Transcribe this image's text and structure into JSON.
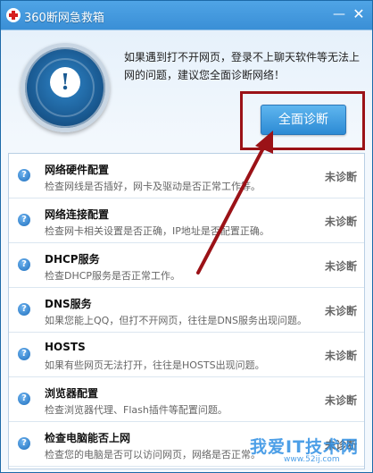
{
  "window": {
    "title": "360断网急救箱",
    "minimize_label": "—",
    "close_label": "✕"
  },
  "hero": {
    "message": "如果遇到打不开网页，登录不上聊天软件等无法上网的问题，建议您全面诊断网络！",
    "diagnose_button": "全面诊断"
  },
  "checks": [
    {
      "title": "网络硬件配置",
      "desc": "检查网线是否插好，网卡及驱动是否正常工作等。",
      "status": "未诊断",
      "icon": "help-icon"
    },
    {
      "title": "网络连接配置",
      "desc": "检查网卡相关设置是否正确，IP地址是否配置正确。",
      "status": "未诊断",
      "icon": "help-icon"
    },
    {
      "title": "DHCP服务",
      "desc": "检查DHCP服务是否正常工作。",
      "status": "未诊断",
      "icon": "help-icon"
    },
    {
      "title": "DNS服务",
      "desc": "如果您能上QQ，但打不开网页，往往是DNS服务出现问题。",
      "status": "未诊断",
      "icon": "help-icon"
    },
    {
      "title": "HOSTS",
      "desc": "如果有些网页无法打开，往往是HOSTS出现问题。",
      "status": "未诊断",
      "icon": "help-icon"
    },
    {
      "title": "浏览器配置",
      "desc": "检查浏览器代理、Flash插件等配置问题。",
      "status": "未诊断",
      "icon": "help-icon"
    },
    {
      "title": "检查电脑能否上网",
      "desc": "检查您的电脑是否可以访问网页，网络是否正常。",
      "status": "未诊断",
      "icon": "help-icon"
    }
  ],
  "watermark": {
    "text": "我爱IT技术网",
    "url": "www.52ij.com"
  },
  "colors": {
    "title_bar": "#3a8fd6",
    "annotation": "#9b1217",
    "button": "#2c8ad4"
  }
}
